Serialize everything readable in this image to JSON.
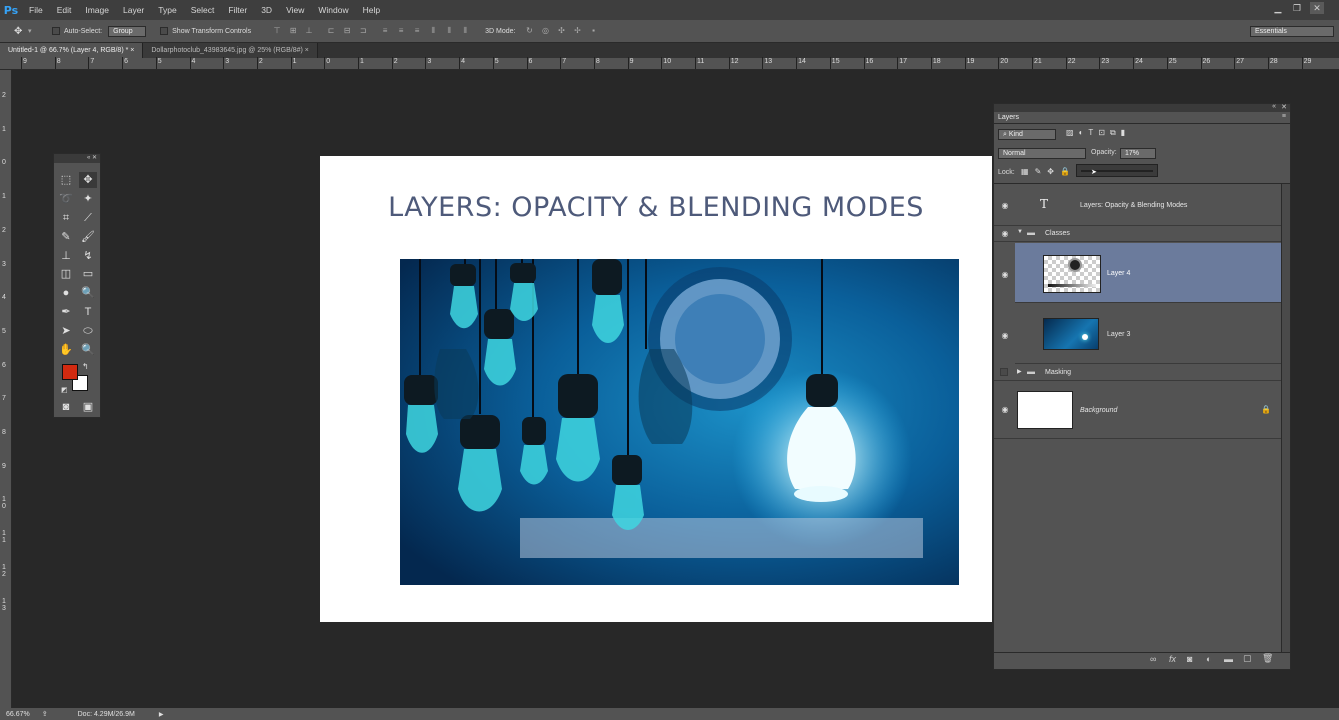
{
  "app": {
    "logo": "Ps"
  },
  "menu": {
    "items": [
      "File",
      "Edit",
      "Image",
      "Layer",
      "Type",
      "Select",
      "Filter",
      "3D",
      "View",
      "Window",
      "Help"
    ]
  },
  "options": {
    "auto_select_label": "Auto-Select:",
    "auto_select_value": "Group",
    "show_transform_label": "Show Transform Controls",
    "mode_3d_label": "3D Mode:",
    "workspace": "Essentials"
  },
  "tabs": [
    {
      "label": "Untitled-1 @ 66.7% (Layer 4, RGB/8) *",
      "active": true
    },
    {
      "label": "Dollarphotoclub_43983645.jpg @ 25% (RGB/8#)",
      "active": false
    }
  ],
  "ruler": {
    "top": [
      "9",
      "8",
      "7",
      "6",
      "5",
      "4",
      "3",
      "2",
      "1",
      "0",
      "1",
      "2",
      "3",
      "4",
      "5",
      "6",
      "7",
      "8",
      "9",
      "10",
      "11",
      "12",
      "13",
      "14",
      "15",
      "16",
      "17",
      "18",
      "19",
      "20",
      "21",
      "22",
      "23",
      "24",
      "25",
      "26",
      "27",
      "28",
      "29"
    ],
    "left": [
      "2",
      "1",
      "0",
      "1",
      "2",
      "3",
      "4",
      "5",
      "6",
      "7",
      "8",
      "9",
      "1\n0",
      "1\n1",
      "1\n2",
      "1\n3"
    ]
  },
  "document": {
    "title": "LAYERS: OPACITY & BLENDING MODES"
  },
  "colors": {
    "foreground": "#d22a10",
    "background": "#ffffff",
    "selection": "#6b7b9c"
  },
  "layers_panel": {
    "title": "Layers",
    "filter_kind": "Kind",
    "blend_mode": "Normal",
    "opacity_label": "Opacity:",
    "opacity_value": "17%",
    "lock_label": "Lock:",
    "layers": [
      {
        "name": "Layers: Opacity & Blending Modes",
        "type": "text"
      },
      {
        "name": "Classes",
        "type": "group"
      },
      {
        "name": "Layer 4",
        "type": "layer"
      },
      {
        "name": "Layer 3",
        "type": "layer"
      },
      {
        "name": "Masking",
        "type": "group"
      },
      {
        "name": "Background",
        "type": "background"
      }
    ]
  },
  "status": {
    "zoom": "66.67%",
    "doc": "Doc: 4.29M/26.9M"
  }
}
